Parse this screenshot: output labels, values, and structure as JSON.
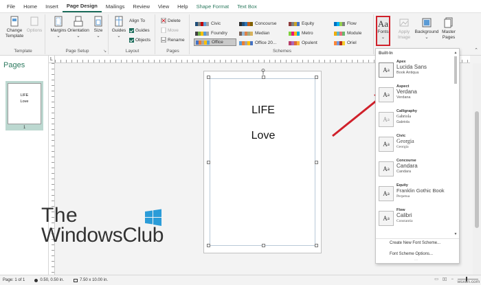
{
  "menubar": {
    "tabs": [
      "File",
      "Home",
      "Insert",
      "Page Design",
      "Mailings",
      "Review",
      "View",
      "Help",
      "Shape Format",
      "Text Box"
    ]
  },
  "ribbon": {
    "template": {
      "change_template": "Change Template",
      "options": "Options",
      "group_label": "Template"
    },
    "page_setup": {
      "margins": "Margins",
      "orientation": "Orientation",
      "size": "Size",
      "group_label": "Page Setup"
    },
    "layout": {
      "guides": "Guides",
      "align_to": "Align To",
      "guides_check": "Guides",
      "objects_check": "Objects",
      "group_label": "Layout"
    },
    "pages": {
      "delete": "Delete",
      "move": "Move",
      "rename": "Rename",
      "group_label": "Pages"
    },
    "schemes": {
      "items": [
        "Civic",
        "Concourse",
        "Equity",
        "Flow",
        "Foundry",
        "Median",
        "Metro",
        "Module",
        "Office",
        "Office 20...",
        "Opulent",
        "Oriel"
      ],
      "group_label": "Schemes"
    },
    "fonts": "Fonts",
    "apply_image": "Apply Image",
    "background": "Background",
    "master_pages": "Master Pages"
  },
  "pages_pane": {
    "title": "Pages",
    "thumb_line1": "LIFE",
    "thumb_line2": "Love",
    "page_number": "1"
  },
  "ruler_corner": "L",
  "document": {
    "line1": "LIFE",
    "line2": "Love"
  },
  "logo": {
    "line1": "The",
    "line2": "WindowsClub"
  },
  "fonts_panel": {
    "header": "Built-In",
    "items": [
      {
        "name": "Apex",
        "main": "Lucida Sans",
        "sub": "Book Antiqua"
      },
      {
        "name": "Aspect",
        "main": "Verdana",
        "sub": "Verdana"
      },
      {
        "name": "Calligraphy",
        "main": "Gabriola",
        "sub": "Gabriola"
      },
      {
        "name": "Civic",
        "main": "Georgia",
        "sub": "Georgia"
      },
      {
        "name": "Concourse",
        "main": "Candara",
        "sub": "Candara"
      },
      {
        "name": "Equity",
        "main": "Franklin Gothic Book",
        "sub": "Perpetua"
      },
      {
        "name": "Flow",
        "main": "Calibri",
        "sub": "Constantia"
      }
    ],
    "create_new": "Create New Font Scheme...",
    "scheme_options": "Font Scheme Options..."
  },
  "statusbar": {
    "page": "Page: 1 of 1",
    "position": "0.50, 0.50 in.",
    "size": "7.50 x 10.00 in."
  },
  "watermark": "wsxdn.com",
  "colors": {
    "accent": "#1a6b5a",
    "highlight_red": "#d0202a"
  }
}
